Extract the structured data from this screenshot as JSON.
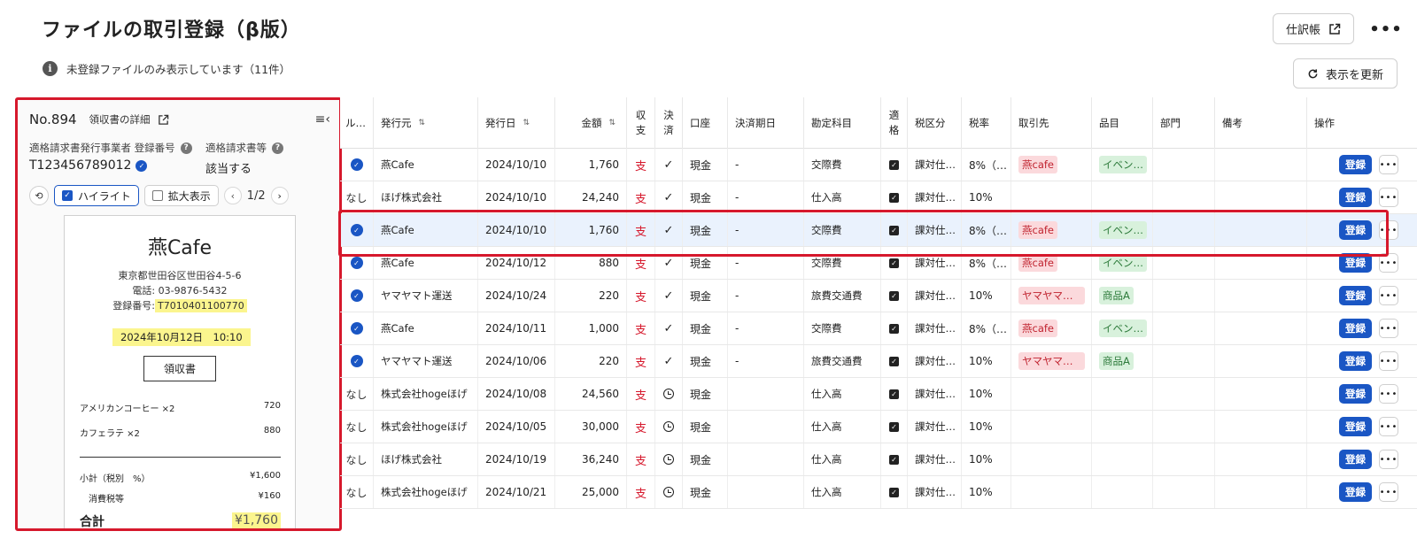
{
  "page": {
    "title": "ファイルの取引登録（β版）",
    "info_text": "未登録ファイルのみ表示しています（11件）",
    "journal_button": "仕訳帳",
    "refresh_button": "表示を更新"
  },
  "detail": {
    "number": "No.894",
    "subtitle": "領収書の詳細",
    "issuer_label": "適格請求書発行事業者 登録番号",
    "issuer_value": "T123456789012",
    "invoice_label": "適格請求書等",
    "invoice_value": "該当する",
    "highlight_label": "ハイライト",
    "zoom_label": "拡大表示",
    "pager": "1/2"
  },
  "receipt": {
    "shop": "燕Cafe",
    "address": "東京都世田谷区世田谷4-5-6",
    "phone": "電話: 03-9876-5432",
    "reg_label": "登録番号:",
    "reg_number": "T7010401100770",
    "datetime": "2024年10月12日　10:10",
    "doc_title": "領収書",
    "items": [
      {
        "name": "アメリカンコーヒー ×2",
        "price": "720"
      },
      {
        "name": "カフェラテ ×2",
        "price": "880"
      }
    ],
    "subtotal_label": "小計（税別　%）",
    "subtotal_value": "¥1,600",
    "tax_label": "消費税等",
    "tax_value": "¥160",
    "total_label": "合計",
    "total_value": "¥1,760"
  },
  "table": {
    "headers": {
      "rule": "ル…",
      "issuer": "発行元",
      "date": "発行日",
      "amount": "金額",
      "shushi_1": "収",
      "shushi_2": "支",
      "kessai_1": "決",
      "kessai_2": "済",
      "account": "口座",
      "due": "決済期日",
      "category": "勘定科目",
      "tekikaku_1": "適",
      "tekikaku_2": "格",
      "tax_type": "税区分",
      "tax_rate": "税率",
      "partner": "取引先",
      "item": "品目",
      "dept": "部門",
      "note": "備考",
      "ops": "操作"
    },
    "register_label": "登録",
    "rows": [
      {
        "rule": "check",
        "issuer": "燕Cafe",
        "date": "2024/10/10",
        "amount": "1,760",
        "shushi": "支",
        "settled": "check",
        "account": "現金",
        "due": "-",
        "category": "交際費",
        "tax_type": "課対仕…",
        "tax_rate": "8%（…",
        "partner": "燕cafe",
        "item": "イベン…",
        "selected": false
      },
      {
        "rule": "なし",
        "issuer": "ほげ株式会社",
        "date": "2024/10/10",
        "amount": "24,240",
        "shushi": "支",
        "settled": "check",
        "account": "現金",
        "due": "-",
        "category": "仕入高",
        "tax_type": "課対仕…",
        "tax_rate": "10%",
        "partner": "",
        "item": "",
        "selected": false
      },
      {
        "rule": "check",
        "issuer": "燕Cafe",
        "date": "2024/10/10",
        "amount": "1,760",
        "shushi": "支",
        "settled": "check",
        "account": "現金",
        "due": "-",
        "category": "交際費",
        "tax_type": "課対仕…",
        "tax_rate": "8%（…",
        "partner": "燕cafe",
        "item": "イベン…",
        "selected": true
      },
      {
        "rule": "check",
        "issuer": "燕Cafe",
        "date": "2024/10/12",
        "amount": "880",
        "shushi": "支",
        "settled": "check",
        "account": "現金",
        "due": "-",
        "category": "交際費",
        "tax_type": "課対仕…",
        "tax_rate": "8%（…",
        "partner": "燕cafe",
        "item": "イベン…",
        "selected": false
      },
      {
        "rule": "check",
        "issuer": "ヤマヤマト運送",
        "date": "2024/10/24",
        "amount": "220",
        "shushi": "支",
        "settled": "check",
        "account": "現金",
        "due": "-",
        "category": "旅費交通費",
        "tax_type": "課対仕…",
        "tax_rate": "10%",
        "partner": "ヤマヤマト…",
        "item": "商品A",
        "selected": false
      },
      {
        "rule": "check",
        "issuer": "燕Cafe",
        "date": "2024/10/11",
        "amount": "1,000",
        "shushi": "支",
        "settled": "check",
        "account": "現金",
        "due": "-",
        "category": "交際費",
        "tax_type": "課対仕…",
        "tax_rate": "8%（…",
        "partner": "燕cafe",
        "item": "イベン…",
        "selected": false
      },
      {
        "rule": "check",
        "issuer": "ヤマヤマト運送",
        "date": "2024/10/06",
        "amount": "220",
        "shushi": "支",
        "settled": "check",
        "account": "現金",
        "due": "-",
        "category": "旅費交通費",
        "tax_type": "課対仕…",
        "tax_rate": "10%",
        "partner": "ヤマヤマト…",
        "item": "商品A",
        "selected": false
      },
      {
        "rule": "なし",
        "issuer": "株式会社hogeほげ",
        "date": "2024/10/08",
        "amount": "24,560",
        "shushi": "支",
        "settled": "clock",
        "account": "現金",
        "due": "",
        "category": "仕入高",
        "tax_type": "課対仕…",
        "tax_rate": "10%",
        "partner": "",
        "item": "",
        "selected": false
      },
      {
        "rule": "なし",
        "issuer": "株式会社hogeほげ",
        "date": "2024/10/05",
        "amount": "30,000",
        "shushi": "支",
        "settled": "clock",
        "account": "現金",
        "due": "",
        "category": "仕入高",
        "tax_type": "課対仕…",
        "tax_rate": "10%",
        "partner": "",
        "item": "",
        "selected": false
      },
      {
        "rule": "なし",
        "issuer": "ほげ株式会社",
        "date": "2024/10/19",
        "amount": "36,240",
        "shushi": "支",
        "settled": "clock",
        "account": "現金",
        "due": "",
        "category": "仕入高",
        "tax_type": "課対仕…",
        "tax_rate": "10%",
        "partner": "",
        "item": "",
        "selected": false
      },
      {
        "rule": "なし",
        "issuer": "株式会社hogeほげ",
        "date": "2024/10/21",
        "amount": "25,000",
        "shushi": "支",
        "settled": "clock",
        "account": "現金",
        "due": "",
        "category": "仕入高",
        "tax_type": "課対仕…",
        "tax_rate": "10%",
        "partner": "",
        "item": "",
        "selected": false
      }
    ]
  }
}
